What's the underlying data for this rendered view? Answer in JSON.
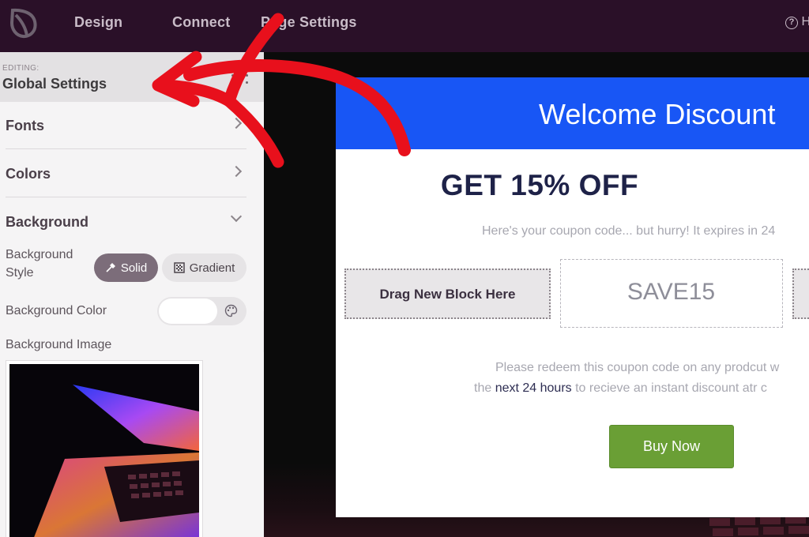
{
  "topbar": {
    "logo_icon": "seedprod-leaf-logo-icon",
    "nav": [
      "Design",
      "Connect",
      "Page Settings"
    ],
    "help_label": "Help"
  },
  "sidebar": {
    "editing_label": "EDITING:",
    "editing_title": "Global Settings",
    "sections": [
      {
        "label": "Fonts",
        "expanded": false
      },
      {
        "label": "Colors",
        "expanded": false
      },
      {
        "label": "Background",
        "expanded": true
      }
    ],
    "background": {
      "style_label": "Background Style",
      "style_options": [
        "Solid",
        "Gradient"
      ],
      "selected_style": "Solid",
      "color_label": "Background Color",
      "color_value": "#ffffff",
      "image_label": "Background Image"
    }
  },
  "popup": {
    "title": "Welcome Discount",
    "headline": "GET 15% OFF",
    "subtext": "Here's your coupon code... but hurry! It expires in 24",
    "drag_block_label": "Drag New Block Here",
    "coupon_code": "SAVE15",
    "body_line1": "Please redeem this coupon code on any prodcut w",
    "body_line2_pre": "the ",
    "body_line2_highlight": "next 24 hours",
    "body_line2_post": " to recieve an instant discount atr c",
    "button_label": "Buy Now"
  },
  "colors": {
    "topbar": "#2a1028",
    "popup_header": "#1856f5",
    "headline": "#1e2248",
    "buy_button": "#6a9f35",
    "arrow": "#e8101c"
  }
}
